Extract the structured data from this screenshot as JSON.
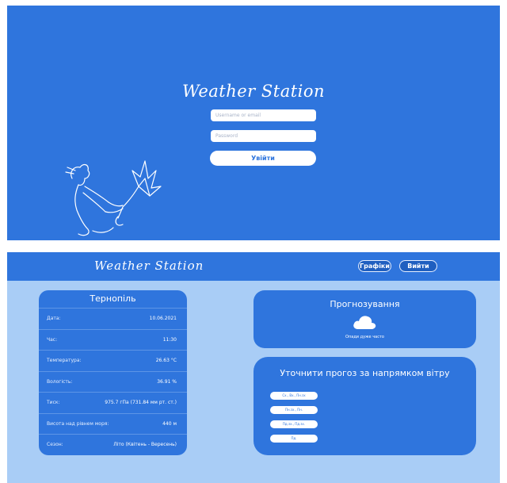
{
  "login": {
    "title": "Weather Station",
    "username_placeholder": "Username or email",
    "password_placeholder": "Password",
    "login_button": "Увійти"
  },
  "dashboard": {
    "logo": "Weather Station",
    "nav": {
      "charts": "Графіки",
      "logout": "Вийти"
    },
    "city_card": {
      "title": "Тернопіль",
      "rows": [
        {
          "label": "Дата:",
          "value": "10.06.2021"
        },
        {
          "label": "Час:",
          "value": "11:30"
        },
        {
          "label": "Температура:",
          "value": "26.63 °С"
        },
        {
          "label": "Вологість:",
          "value": "36.91 %"
        },
        {
          "label": "Тиск:",
          "value": "975.7 гПа (731.84 мм рт. ст.)"
        },
        {
          "label": "Висота над рівнем моря:",
          "value": "440 м"
        },
        {
          "label": "Сезон:",
          "value": "Літо (Квітень - Вересень)"
        }
      ]
    },
    "forecast_card": {
      "title": "Прогнозування",
      "icon": "cloud-icon",
      "text": "Опади дуже часто"
    },
    "wind_card": {
      "title": "Уточнити прогоз за напрямком вітру",
      "buttons": [
        "Сх., Вх., Пн.зх",
        "Пн.зх., Пн.",
        "Пд.зх., Пд.зх.",
        "Пд."
      ]
    }
  },
  "colors": {
    "primary": "#2f75dd",
    "background_light": "#a9cdf6",
    "text": "#ffffff"
  }
}
